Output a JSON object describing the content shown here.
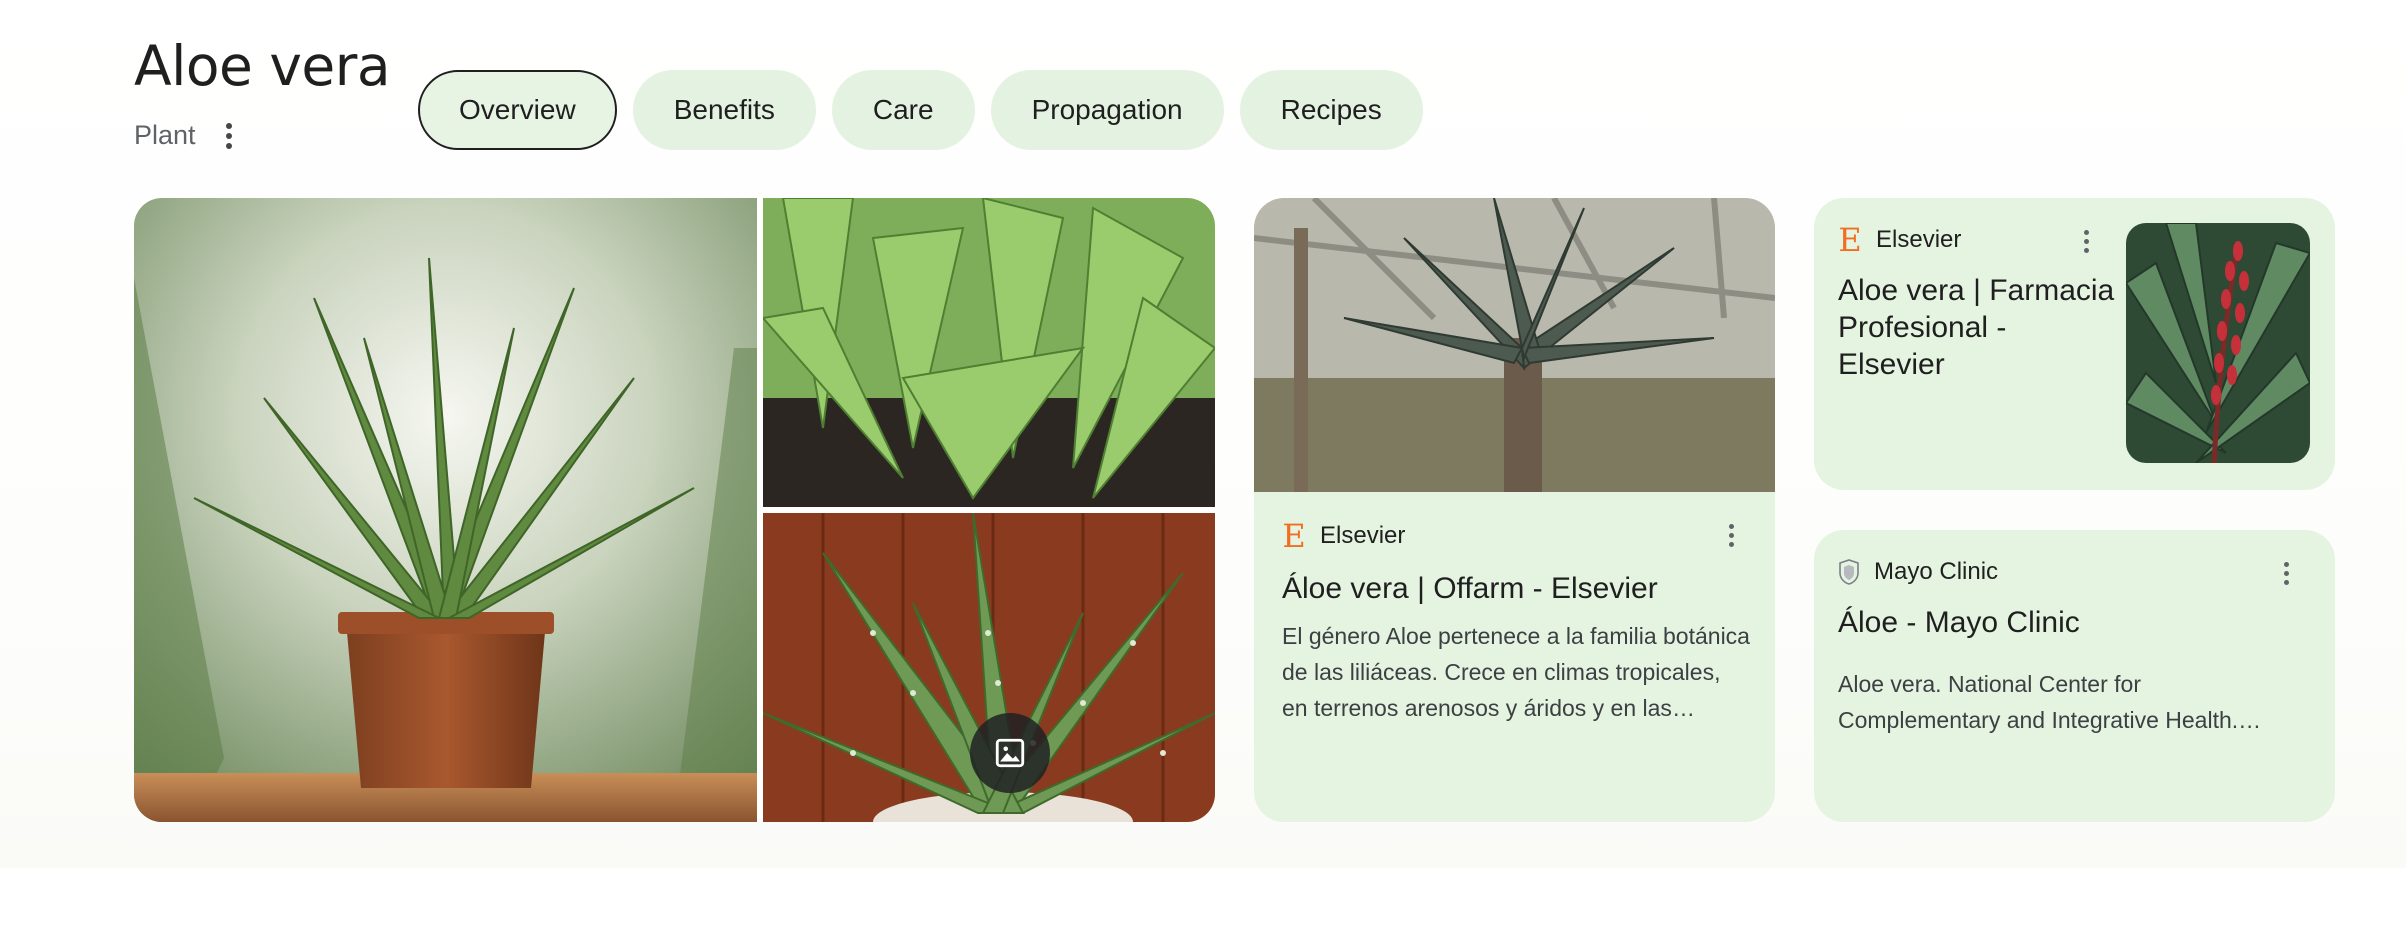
{
  "entity": {
    "title": "Aloe vera",
    "subtitle": "Plant",
    "more_icon": "vertical-dots-icon"
  },
  "tabs": [
    {
      "label": "Overview",
      "active": true
    },
    {
      "label": "Benefits",
      "active": false
    },
    {
      "label": "Care",
      "active": false
    },
    {
      "label": "Propagation",
      "active": false
    },
    {
      "label": "Recipes",
      "active": false
    }
  ],
  "gallery": {
    "images": [
      {
        "subject": "potted aloe vera plant on wooden table"
      },
      {
        "subject": "young aloe vera plants growing in soil"
      },
      {
        "subject": "aloe vera rosette with white spots against wooden wall"
      }
    ],
    "more_images_icon": "image-gallery-icon"
  },
  "results": [
    {
      "source": "Elsevier",
      "source_icon": "elsevier-logo-icon",
      "title": "Áloe vera | Offarm - Elsevier",
      "snippet": "El género Aloe pertenece a la familia botánica de las liliáceas. Crece en climas tropicales, en terrenos arenosos y áridos y en las regiones secas de África, Asia, Europa y América.",
      "thumbnail": "large aloe plant in greenhouse"
    },
    {
      "source": "Elsevier",
      "source_icon": "elsevier-logo-icon",
      "title": "Aloe vera | Farmacia Profesional - Elsevier",
      "thumbnail": "aloe plant with red flower spike"
    },
    {
      "source": "Mayo Clinic",
      "source_icon": "mayo-clinic-logo-icon",
      "title": "Áloe - Mayo Clinic",
      "snippet": "Aloe vera. National Center for Complementary and Integrative Health. https://www.nccih.nih.gov/health/aloe-vera."
    }
  ],
  "colors": {
    "tab_background": "#e4f3e1",
    "card_background": "#e5f3e1",
    "elsevier_orange": "#f26d21",
    "text_primary": "#1f1f1f",
    "text_secondary": "#5f6368"
  }
}
